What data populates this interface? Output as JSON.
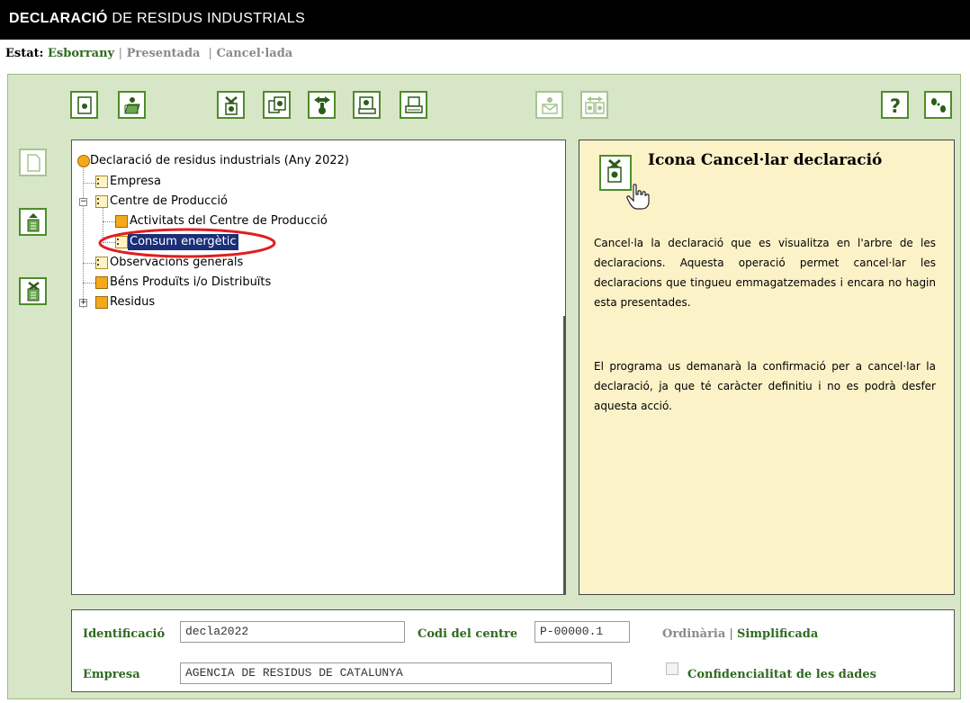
{
  "header": {
    "title_bold": "DECLARACIÓ",
    "title_rest": " DE RESIDUS INDUSTRIALS"
  },
  "status_bar": {
    "label": "Estat:",
    "states": [
      "Esborrany",
      "Presentada",
      "Cancel·lada"
    ],
    "separators": [
      "|",
      "|"
    ],
    "active_state": "Esborrany"
  },
  "toolbar": {
    "icons": [
      "new-declaration-icon",
      "open-declaration-icon",
      "cancel-declaration-icon",
      "copy-declaration-icon",
      "transfer-icon",
      "validate-icon",
      "print-icon",
      "send-mail-icon",
      "compare-icon",
      "help-icon",
      "guide-icon"
    ]
  },
  "side_toolbar": {
    "icons": [
      "blank-page-icon",
      "add-record-icon",
      "delete-record-icon"
    ]
  },
  "tree": {
    "root": "Declaració de residus industrials (Any 2022)",
    "nodes": [
      {
        "label": "Empresa",
        "level": 1
      },
      {
        "label": "Centre de Producció",
        "level": 1,
        "expander": "−"
      },
      {
        "label": "Activitats del Centre de Producció",
        "level": 2
      },
      {
        "label": "Consum energètic",
        "level": 2,
        "selected": true
      },
      {
        "label": "Observacions generals",
        "level": 1
      },
      {
        "label": "Béns Produïts i/o Distribuïts",
        "level": 1
      },
      {
        "label": "Residus",
        "level": 1,
        "expander": "+"
      }
    ]
  },
  "help": {
    "title": "Icona Cancel·lar declaració",
    "paragraph1": "Cancel·la la declaració que es visualitza en l'arbre de les declaracions. Aquesta operació permet cancel·lar les declaracions que tingueu emmagatzemades i encara no hagin esta presentades.",
    "paragraph2": "El programa us demanarà la confirmació per a cancel·lar la declaració, ja que té caràcter definitiu i no es podrà desfer aquesta acció."
  },
  "form": {
    "identificacio_label": "Identificació",
    "identificacio_value": "decla2022",
    "codi_label": "Codi del centre",
    "codi_value": "P-00000.1",
    "type_options": [
      "Ordinària",
      "Simplificada"
    ],
    "type_separator": "|",
    "type_selected": "Simplificada",
    "empresa_label": "Empresa",
    "empresa_value": "AGENCIA DE RESIDUS DE CATALUNYA",
    "confidencialitat_label": "Confidencialitat de les dades",
    "confidencialitat_checked": false
  },
  "colors": {
    "accent_green": "#2e6a1f",
    "panel_bg": "#d6e6c7",
    "help_bg": "#fcf2c8",
    "selection": "#1a2f77",
    "highlight_ellipse": "#e01e1e"
  }
}
